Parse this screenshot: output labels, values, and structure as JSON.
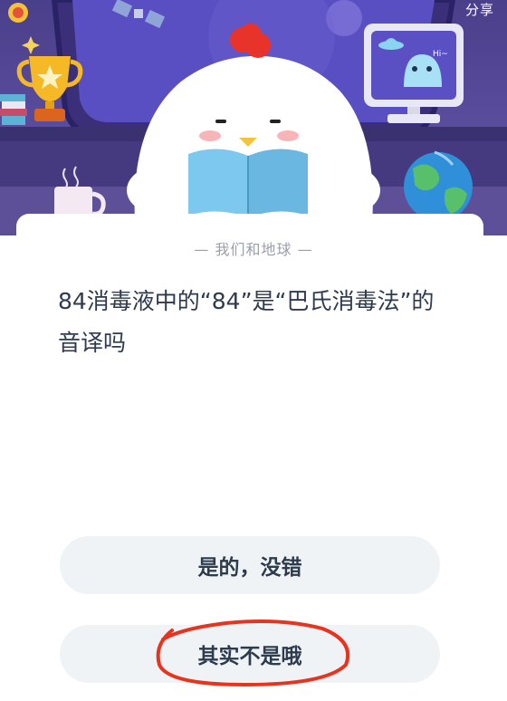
{
  "header": {
    "share_label": "分享",
    "monitor_text": "Hi~"
  },
  "quiz": {
    "category": "— 我们和地球 —",
    "question": "84消毒液中的“84”是“巴氏消毒法”的音译吗",
    "options": [
      {
        "label": "是的，没错"
      },
      {
        "label": "其实不是哦"
      }
    ]
  },
  "colors": {
    "scene_bg": "#5b4d9e",
    "option_bg": "#f0f3f6",
    "annotation_red": "#e8331f"
  }
}
